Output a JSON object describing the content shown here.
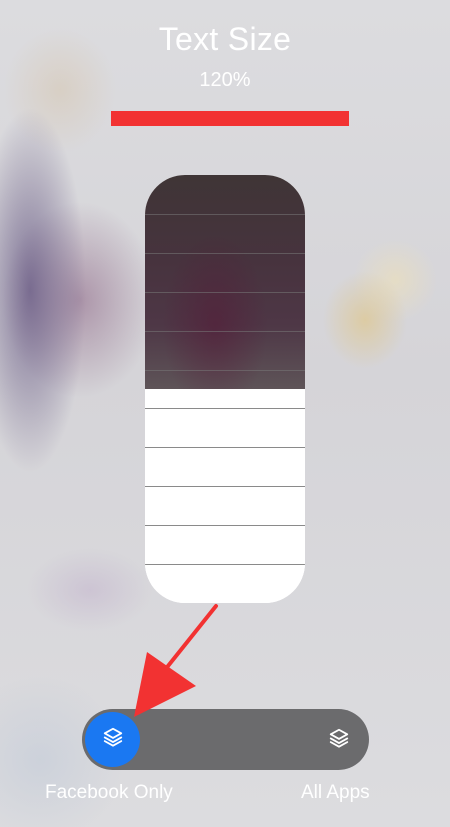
{
  "header": {
    "title": "Text Size",
    "percent_label": "120%"
  },
  "slider": {
    "level": 0.5,
    "steps": 11,
    "accent": "#ffffff"
  },
  "scope_toggle": {
    "selected": "facebook_only",
    "left_label": "Facebook Only",
    "right_label": "All Apps",
    "left_icon": "layers-icon",
    "right_icon": "layers-icon",
    "accent": "#1a78f2"
  },
  "annotations": {
    "highlight_bar_color": "#f23232",
    "arrow_color": "#f23232"
  }
}
